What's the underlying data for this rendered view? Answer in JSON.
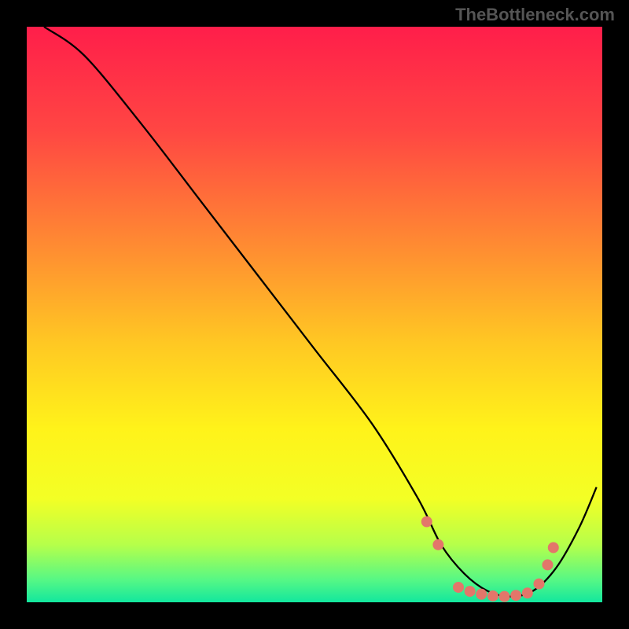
{
  "watermark": "TheBottleneck.com",
  "chart_data": {
    "type": "line",
    "title": "",
    "xlabel": "",
    "ylabel": "",
    "xlim": [
      0,
      100
    ],
    "ylim": [
      0,
      100
    ],
    "series": [
      {
        "name": "curve",
        "color": "#000000",
        "x": [
          3,
          10,
          20,
          30,
          40,
          50,
          60,
          68,
          72,
          76,
          80,
          84,
          88,
          92,
          96,
          99
        ],
        "y": [
          100,
          95,
          83,
          70,
          57,
          44,
          31,
          18,
          10,
          5,
          2,
          1,
          2,
          6,
          13,
          20
        ]
      }
    ],
    "markers": {
      "name": "dots",
      "color": "#e3766a",
      "radius": 7,
      "x": [
        69.5,
        71.5,
        75,
        77,
        79,
        81,
        83,
        85,
        87,
        89,
        90.5,
        91.5
      ],
      "y": [
        14,
        10,
        2.6,
        1.9,
        1.4,
        1.1,
        1.0,
        1.2,
        1.6,
        3.2,
        6.5,
        9.5
      ]
    },
    "background_gradient_stops": [
      {
        "offset": 0.0,
        "color": "#ff1e4a"
      },
      {
        "offset": 0.18,
        "color": "#ff4643"
      },
      {
        "offset": 0.38,
        "color": "#ff8b32"
      },
      {
        "offset": 0.55,
        "color": "#ffc823"
      },
      {
        "offset": 0.7,
        "color": "#fff31a"
      },
      {
        "offset": 0.82,
        "color": "#f3ff25"
      },
      {
        "offset": 0.9,
        "color": "#b6ff4a"
      },
      {
        "offset": 0.96,
        "color": "#58f884"
      },
      {
        "offset": 1.0,
        "color": "#12e79e"
      }
    ]
  }
}
